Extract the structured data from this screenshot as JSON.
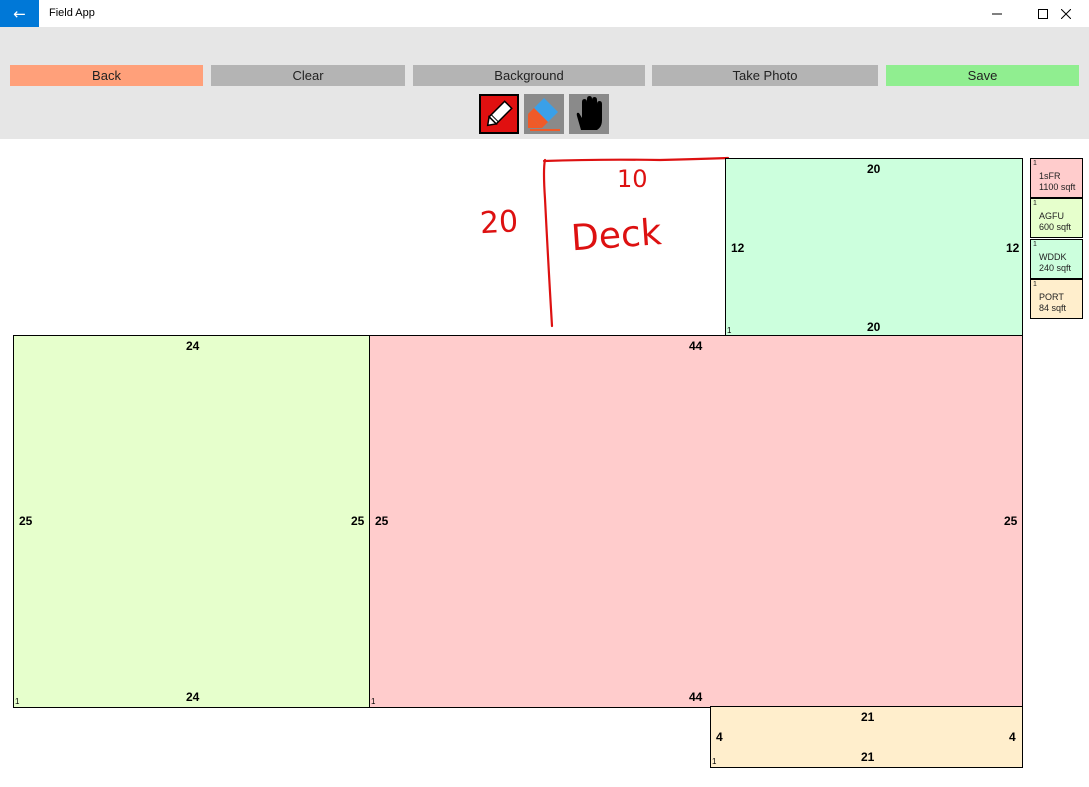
{
  "window": {
    "title": "Field App",
    "back_icon": "back-arrow-icon",
    "controls": [
      "minimize-icon",
      "maximize-icon",
      "close-icon"
    ]
  },
  "toolbar": {
    "back_label": "Back",
    "clear_label": "Clear",
    "background_label": "Background",
    "take_photo_label": "Take Photo",
    "save_label": "Save",
    "colors": {
      "back": "#ffa07a",
      "neutral": "#b4b4b4",
      "save": "#90ee90",
      "bar": "#e6e6e6"
    },
    "tools": [
      "pencil-icon",
      "eraser-icon",
      "hand-pan-icon"
    ]
  },
  "sketch": {
    "handwriting": {
      "width_label": "20",
      "depth_label": "10",
      "area_name": "Deck",
      "ink_color": "#dd1111"
    },
    "areas": [
      {
        "code": "WDDK",
        "color": "#ccffdd",
        "top": "20",
        "bottom": "20",
        "left": "12",
        "right": "12",
        "corner": "1"
      },
      {
        "code": "AGFU",
        "color": "#e6ffcc",
        "top": "24",
        "bottom": "24",
        "left": "25",
        "right": "25",
        "corner": "1"
      },
      {
        "code": "1sFR",
        "color": "#ffcccc",
        "top": "44",
        "bottom": "44",
        "left": "25",
        "right": "25",
        "corner": "1"
      },
      {
        "code": "PORT",
        "color": "#ffeecc",
        "top": "21",
        "bottom": "21",
        "left": "4",
        "right": "4",
        "corner": "1"
      }
    ]
  },
  "legend": [
    {
      "num": "1",
      "code": "1sFR",
      "area": "1100 sqft",
      "color": "#ffcccc"
    },
    {
      "num": "1",
      "code": "AGFU",
      "area": "600 sqft",
      "color": "#e6ffcc"
    },
    {
      "num": "1",
      "code": "WDDK",
      "area": "240 sqft",
      "color": "#ccffdd"
    },
    {
      "num": "1",
      "code": "PORT",
      "area": "84 sqft",
      "color": "#ffeecc"
    }
  ]
}
